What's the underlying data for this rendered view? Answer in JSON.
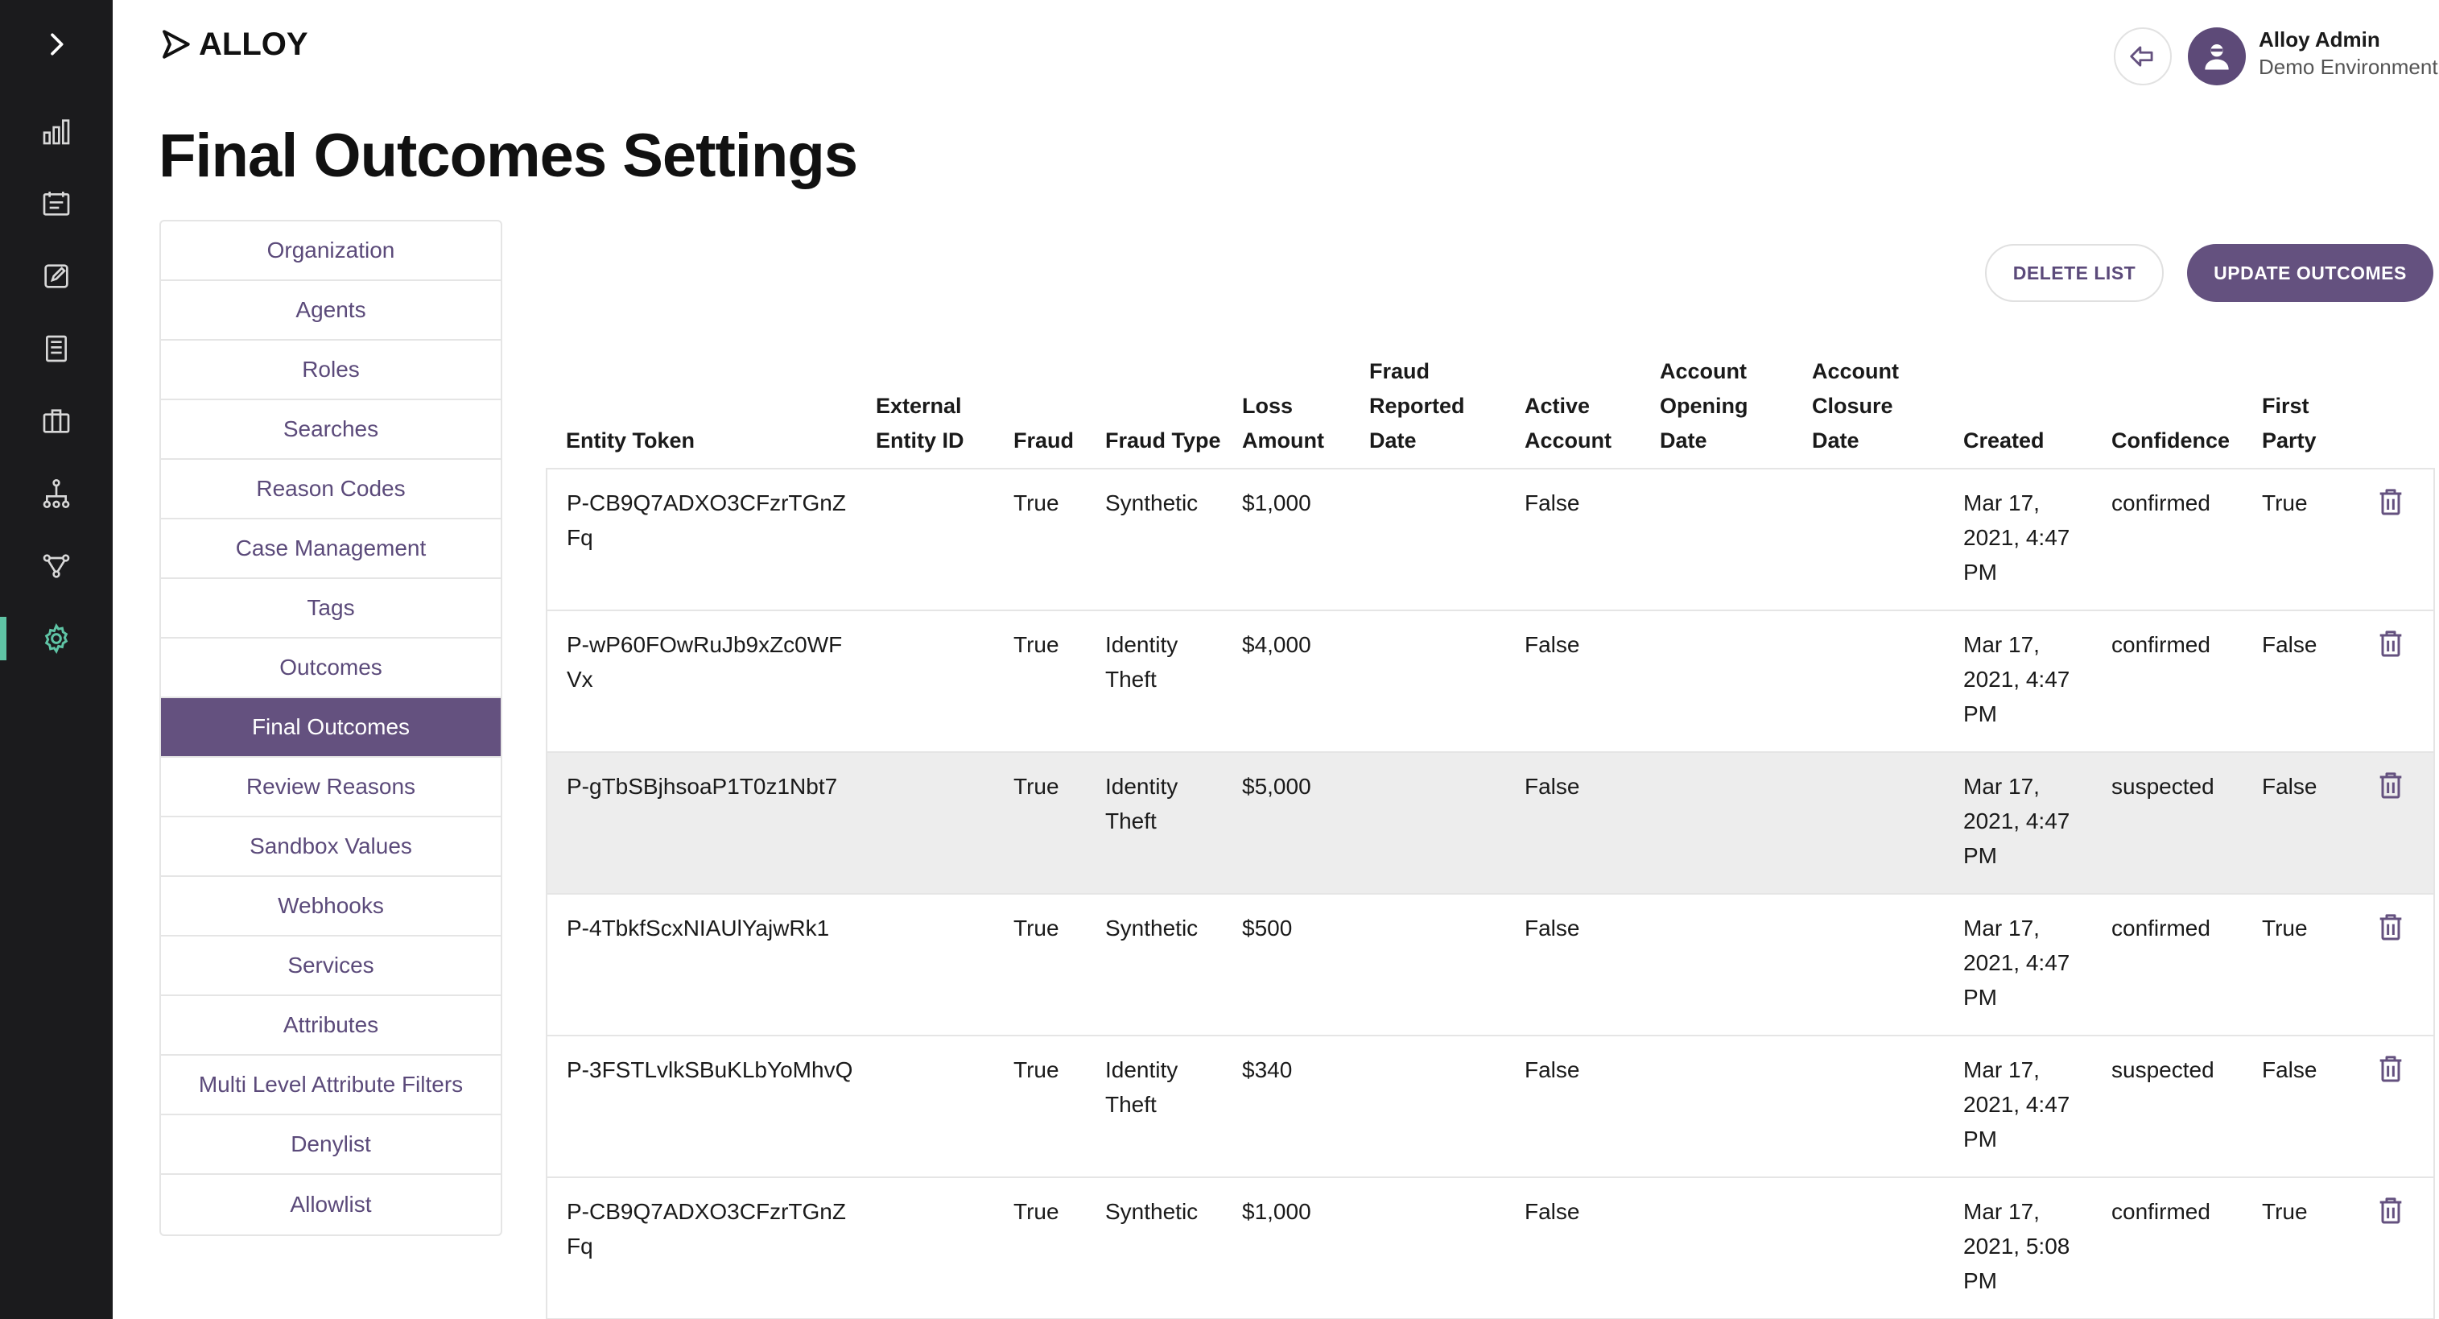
{
  "app": {
    "logo_text": "ALLOY",
    "user_name": "Alloy Admin",
    "user_environment": "Demo Environment",
    "accent_color": "#64517f",
    "rail_active_color": "#5fc4a5"
  },
  "rail": {
    "items": [
      {
        "icon": "chevron-right-icon"
      },
      {
        "icon": "bar-chart-icon"
      },
      {
        "icon": "calendar-list-icon"
      },
      {
        "icon": "edit-icon"
      },
      {
        "icon": "document-icon"
      },
      {
        "icon": "briefcase-icon"
      },
      {
        "icon": "hierarchy-icon"
      },
      {
        "icon": "workflow-icon"
      },
      {
        "icon": "gear-icon",
        "active": true
      }
    ]
  },
  "page": {
    "title": "Final Outcomes Settings"
  },
  "settings_nav": {
    "items": [
      "Organization",
      "Agents",
      "Roles",
      "Searches",
      "Reason Codes",
      "Case Management",
      "Tags",
      "Outcomes",
      "Final Outcomes",
      "Review Reasons",
      "Sandbox Values",
      "Webhooks",
      "Services",
      "Attributes",
      "Multi Level Attribute Filters",
      "Denylist",
      "Allowlist"
    ],
    "active": "Final Outcomes"
  },
  "actions": {
    "delete_label": "DELETE LIST",
    "update_label": "UPDATE OUTCOMES"
  },
  "table": {
    "headers": [
      "Entity Token",
      "External Entity ID",
      "Fraud",
      "Fraud Type",
      "Loss Amount",
      "Fraud Reported Date",
      "Active Account",
      "Account Opening Date",
      "Account Closure Date",
      "Created",
      "Confidence",
      "First Party"
    ],
    "rows": [
      {
        "entity_token": "P-CB9Q7ADXO3CFzrTGnZFq",
        "external_id": "",
        "fraud": "True",
        "fraud_type": "Synthetic",
        "loss_amount": "$1,000",
        "fraud_reported_date": "",
        "active_account": "False",
        "opening_date": "",
        "closure_date": "",
        "created": "Mar 17, 2021, 4:47 PM",
        "confidence": "confirmed",
        "first_party": "True"
      },
      {
        "entity_token": "P-wP60FOwRuJb9xZc0WFVx",
        "external_id": "",
        "fraud": "True",
        "fraud_type": "Identity Theft",
        "loss_amount": "$4,000",
        "fraud_reported_date": "",
        "active_account": "False",
        "opening_date": "",
        "closure_date": "",
        "created": "Mar 17, 2021, 4:47 PM",
        "confidence": "confirmed",
        "first_party": "False"
      },
      {
        "entity_token": "P-gTbSBjhsoaP1T0z1Nbt7",
        "external_id": "",
        "fraud": "True",
        "fraud_type": "Identity Theft",
        "loss_amount": "$5,000",
        "fraud_reported_date": "",
        "active_account": "False",
        "opening_date": "",
        "closure_date": "",
        "created": "Mar 17, 2021, 4:47 PM",
        "confidence": "suspected",
        "first_party": "False",
        "highlighted": true
      },
      {
        "entity_token": "P-4TbkfScxNIAUlYajwRk1",
        "external_id": "",
        "fraud": "True",
        "fraud_type": "Synthetic",
        "loss_amount": "$500",
        "fraud_reported_date": "",
        "active_account": "False",
        "opening_date": "",
        "closure_date": "",
        "created": "Mar 17, 2021, 4:47 PM",
        "confidence": "confirmed",
        "first_party": "True"
      },
      {
        "entity_token": "P-3FSTLvlkSBuKLbYoMhvQ",
        "external_id": "",
        "fraud": "True",
        "fraud_type": "Identity Theft",
        "loss_amount": "$340",
        "fraud_reported_date": "",
        "active_account": "False",
        "opening_date": "",
        "closure_date": "",
        "created": "Mar 17, 2021, 4:47 PM",
        "confidence": "suspected",
        "first_party": "False"
      },
      {
        "entity_token": "P-CB9Q7ADXO3CFzrTGnZFq",
        "external_id": "",
        "fraud": "True",
        "fraud_type": "Synthetic",
        "loss_amount": "$1,000",
        "fraud_reported_date": "",
        "active_account": "False",
        "opening_date": "",
        "closure_date": "",
        "created": "Mar 17, 2021, 5:08 PM",
        "confidence": "confirmed",
        "first_party": "True"
      }
    ]
  }
}
